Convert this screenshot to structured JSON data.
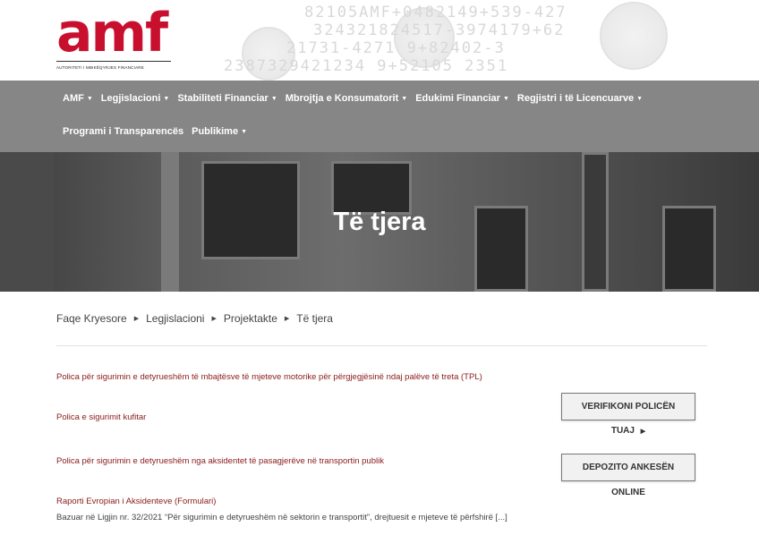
{
  "logo": {
    "text": "amf",
    "tagline": "AUTORITETI I MBIKËQYRJES FINANCIARE"
  },
  "header_decor": {
    "strings": [
      "82105AMF+0482149+539-427",
      "324321824517-3974179+62",
      "21731-4271    9+82402-3",
      "2387329421234    9+52105 2351"
    ]
  },
  "nav": {
    "row1": [
      {
        "label": "AMF",
        "dropdown": true
      },
      {
        "label": "Legjislacioni",
        "dropdown": true
      },
      {
        "label": "Stabiliteti Financiar",
        "dropdown": true
      },
      {
        "label": "Mbrojtja e Konsumatorit",
        "dropdown": true
      },
      {
        "label": "Edukimi Financiar",
        "dropdown": true
      },
      {
        "label": "Regjistri i të Licencuarve",
        "dropdown": true
      }
    ],
    "row2": [
      {
        "label": "Programi i Transparencës",
        "dropdown": false
      },
      {
        "label": "Publikime",
        "dropdown": true
      }
    ]
  },
  "hero": {
    "title": "Të tjera"
  },
  "breadcrumb": [
    "Faqe Kryesore",
    "Legjislacioni",
    "Projektakte",
    "Të tjera"
  ],
  "documents": [
    {
      "title": "Polica për sigurimin e detyrueshëm të mbajtësve të mjeteve motorike për përgjegjësinë ndaj palëve të treta (TPL)"
    },
    {
      "title": "Polica e sigurimit kufitar"
    },
    {
      "title": "Polica për sigurimin e detyrueshëm nga aksidentet të pasagjerëve në transportin publik"
    },
    {
      "title": "Raporti Evropian i Aksidenteve (Formulari)",
      "description": "Bazuar në Ligjin nr. 32/2021 “Për sigurimin e detyrueshëm në sektorin e transportit”, drejtuesit e mjeteve të përfshirë [...]"
    }
  ],
  "sidebar": {
    "verify_button": "VERIFIKONI POLICËN",
    "verify_sub": "TUAJ",
    "complaint_button": "DEPOZITO ANKESËN",
    "complaint_sub": "ONLINE"
  },
  "colors": {
    "brand_red": "#c8102e",
    "nav_bg": "#868686",
    "link_color": "#8b1a1a"
  }
}
